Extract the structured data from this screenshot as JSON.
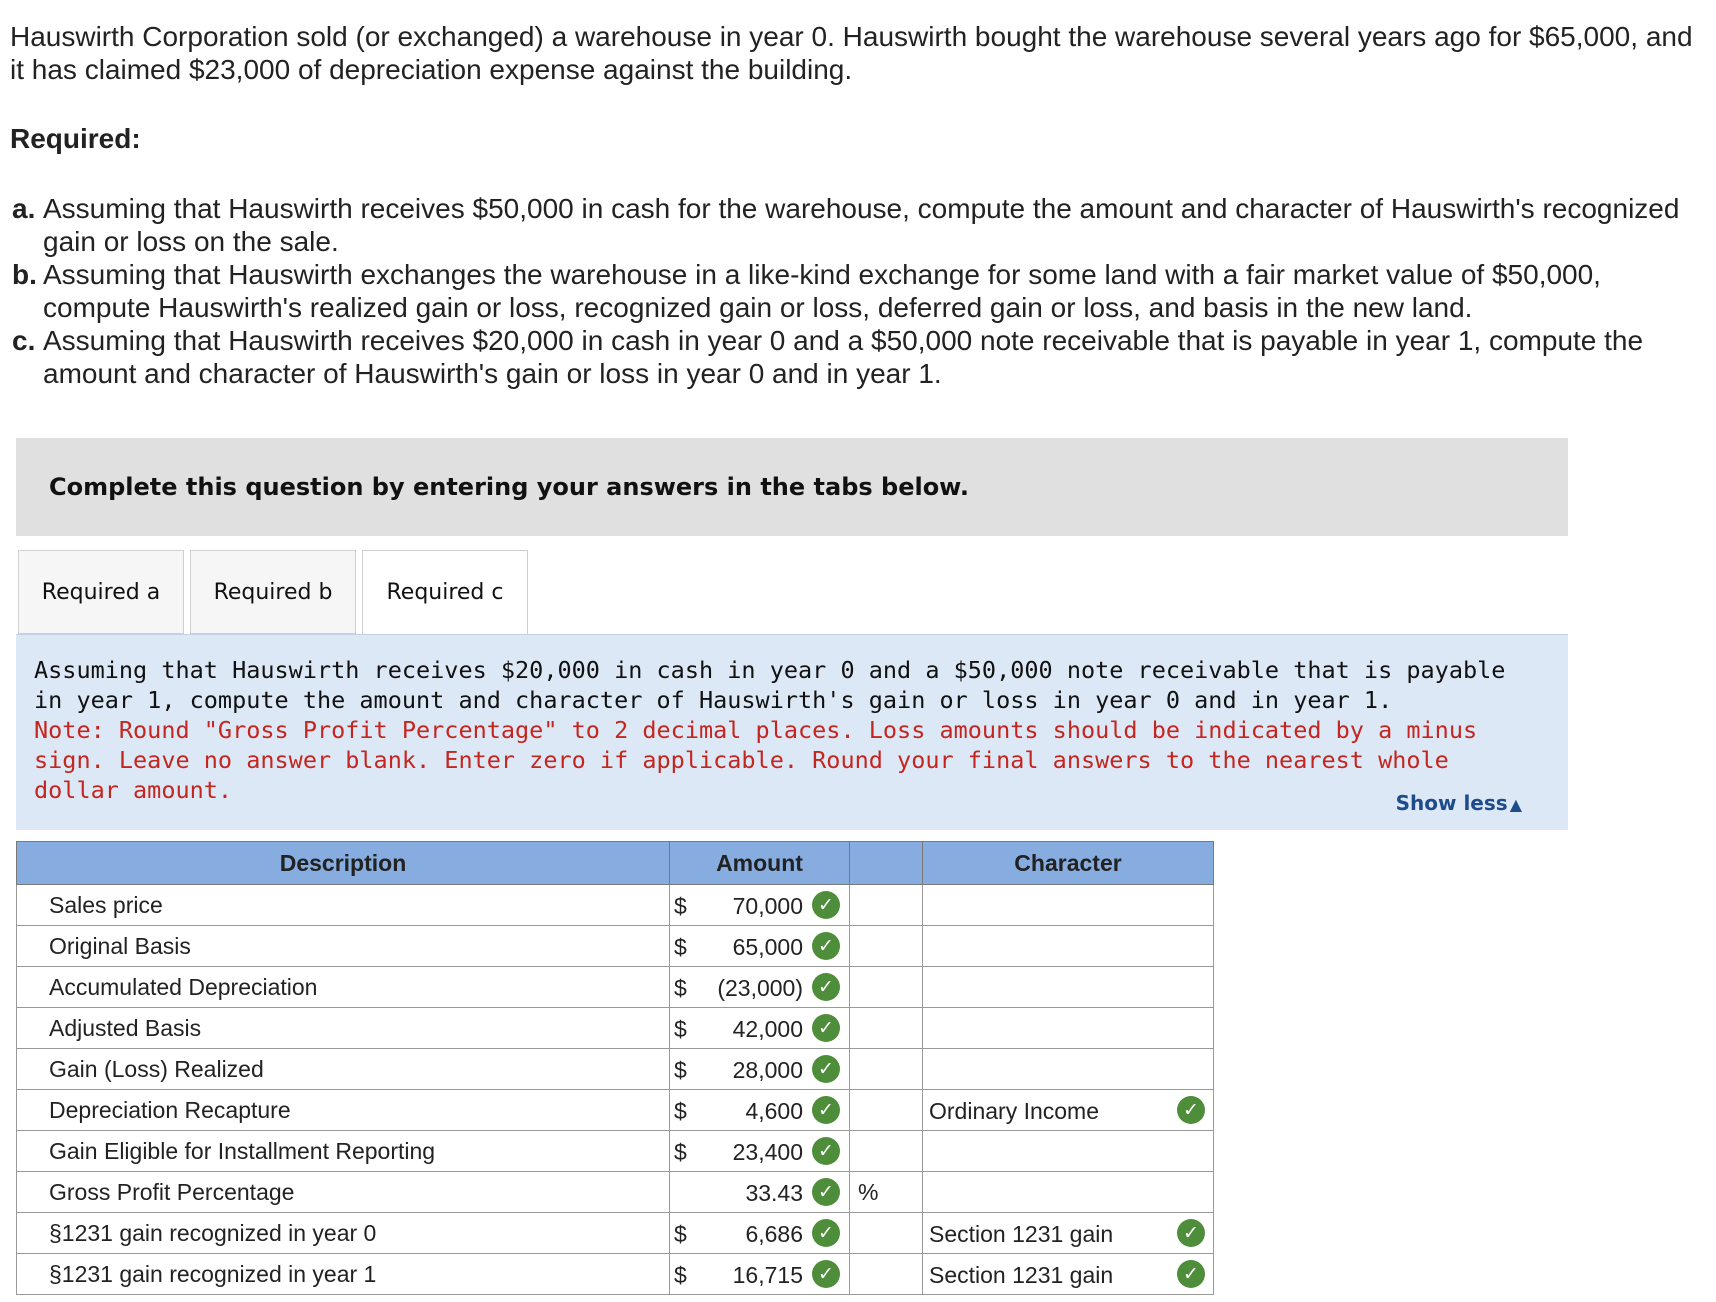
{
  "intro": {
    "text": "Hauswirth Corporation sold (or exchanged) a warehouse in year 0. Hauswirth bought the warehouse several years ago for $65,000, and it has claimed $23,000 of depreciation expense against the building."
  },
  "required": {
    "heading": "Required:",
    "items": [
      {
        "letter": "a.",
        "text": "Assuming that Hauswirth receives $50,000 in cash for the warehouse, compute the amount and character of Hauswirth's recognized gain or loss on the sale."
      },
      {
        "letter": "b.",
        "text": "Assuming that Hauswirth exchanges the warehouse in a like-kind exchange for some land with a fair market value of $50,000, compute Hauswirth's realized gain or loss, recognized gain or loss, deferred gain or loss, and basis in the new land."
      },
      {
        "letter": "c.",
        "text": "Assuming that Hauswirth receives $20,000 in cash in year 0 and a $50,000 note receivable that is payable in year 1, compute the amount and character of Hauswirth's gain or loss in year 0 and in year 1."
      }
    ]
  },
  "banner": {
    "text": "Complete this question by entering your answers in the tabs below."
  },
  "tabs": [
    {
      "label": "Required a",
      "active": false
    },
    {
      "label": "Required b",
      "active": false
    },
    {
      "label": "Required c",
      "active": true
    }
  ],
  "panel": {
    "instruction": "Assuming that Hauswirth receives $20,000 in cash in year 0 and a $50,000 note receivable that is payable in year 1, compute the amount and character of Hauswirth's gain or loss in year 0 and in year 1.",
    "note": "Note: Round \"Gross Profit Percentage\" to 2 decimal places. Loss amounts should be indicated by a minus sign. Leave no answer blank. Enter zero if applicable. Round your final answers to the nearest whole dollar amount.",
    "show_less": "Show less",
    "show_less_icon": "triangle-up-icon"
  },
  "table": {
    "headers": {
      "description": "Description",
      "amount": "Amount",
      "blank": "",
      "character": "Character"
    },
    "currency_symbol": "$",
    "check_glyph": "✓",
    "check_color": "#4e8d3a",
    "header_color": "#86ace0",
    "rows": [
      {
        "description": "Sales price",
        "dollar": "$",
        "amount": "70,000",
        "pct": "",
        "character": "",
        "character_check": false
      },
      {
        "description": "Original Basis",
        "dollar": "$",
        "amount": "65,000",
        "pct": "",
        "character": "",
        "character_check": false
      },
      {
        "description": "Accumulated Depreciation",
        "dollar": "$",
        "amount": "(23,000)",
        "pct": "",
        "character": "",
        "character_check": false
      },
      {
        "description": "Adjusted Basis",
        "dollar": "$",
        "amount": "42,000",
        "pct": "",
        "character": "",
        "character_check": false
      },
      {
        "description": "Gain (Loss) Realized",
        "dollar": "$",
        "amount": "28,000",
        "pct": "",
        "character": "",
        "character_check": false
      },
      {
        "description": "Depreciation Recapture",
        "dollar": "$",
        "amount": "4,600",
        "pct": "",
        "character": "Ordinary Income",
        "character_check": true
      },
      {
        "description": "Gain Eligible for Installment Reporting",
        "dollar": "$",
        "amount": "23,400",
        "pct": "",
        "character": "",
        "character_check": false
      },
      {
        "description": "Gross Profit Percentage",
        "dollar": "",
        "amount": "33.43",
        "pct": "%",
        "character": "",
        "character_check": false
      },
      {
        "description": "§1231 gain recognized in year 0",
        "dollar": "$",
        "amount": "6,686",
        "pct": "",
        "character": "Section 1231 gain",
        "character_check": true
      },
      {
        "description": "§1231 gain recognized in year 1",
        "dollar": "$",
        "amount": "16,715",
        "pct": "",
        "character": "Section 1231 gain",
        "character_check": true
      }
    ]
  }
}
